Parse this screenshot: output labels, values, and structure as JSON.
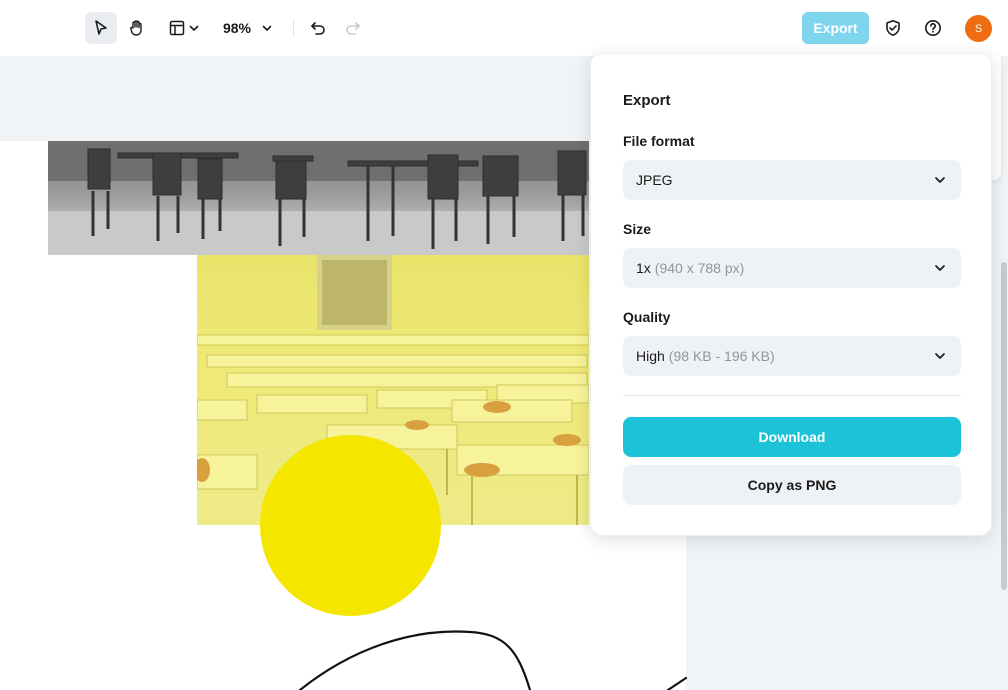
{
  "toolbar": {
    "icons": {
      "select": "pointer-arrow-icon",
      "hand": "hand-icon",
      "layout": "layout-icon",
      "undo": "undo-icon",
      "redo": "redo-icon",
      "shield": "shield-check-icon",
      "help": "help-circle-icon"
    },
    "zoom": "98%",
    "export_label": "Export",
    "avatar_initial": "S"
  },
  "colors": {
    "accent": "#1cc3d8",
    "export_disabled": "#7fd4ee",
    "avatar": "#ef6d10",
    "circle": "#f5e600"
  },
  "export_panel": {
    "title": "Export",
    "file_format": {
      "label": "File format",
      "value": "JPEG"
    },
    "size": {
      "label": "Size",
      "value": "1x",
      "detail": "(940 x 788 px)"
    },
    "quality": {
      "label": "Quality",
      "value": "High",
      "detail": "(98 KB - 196 KB)"
    },
    "download_label": "Download",
    "copy_label": "Copy as PNG"
  }
}
